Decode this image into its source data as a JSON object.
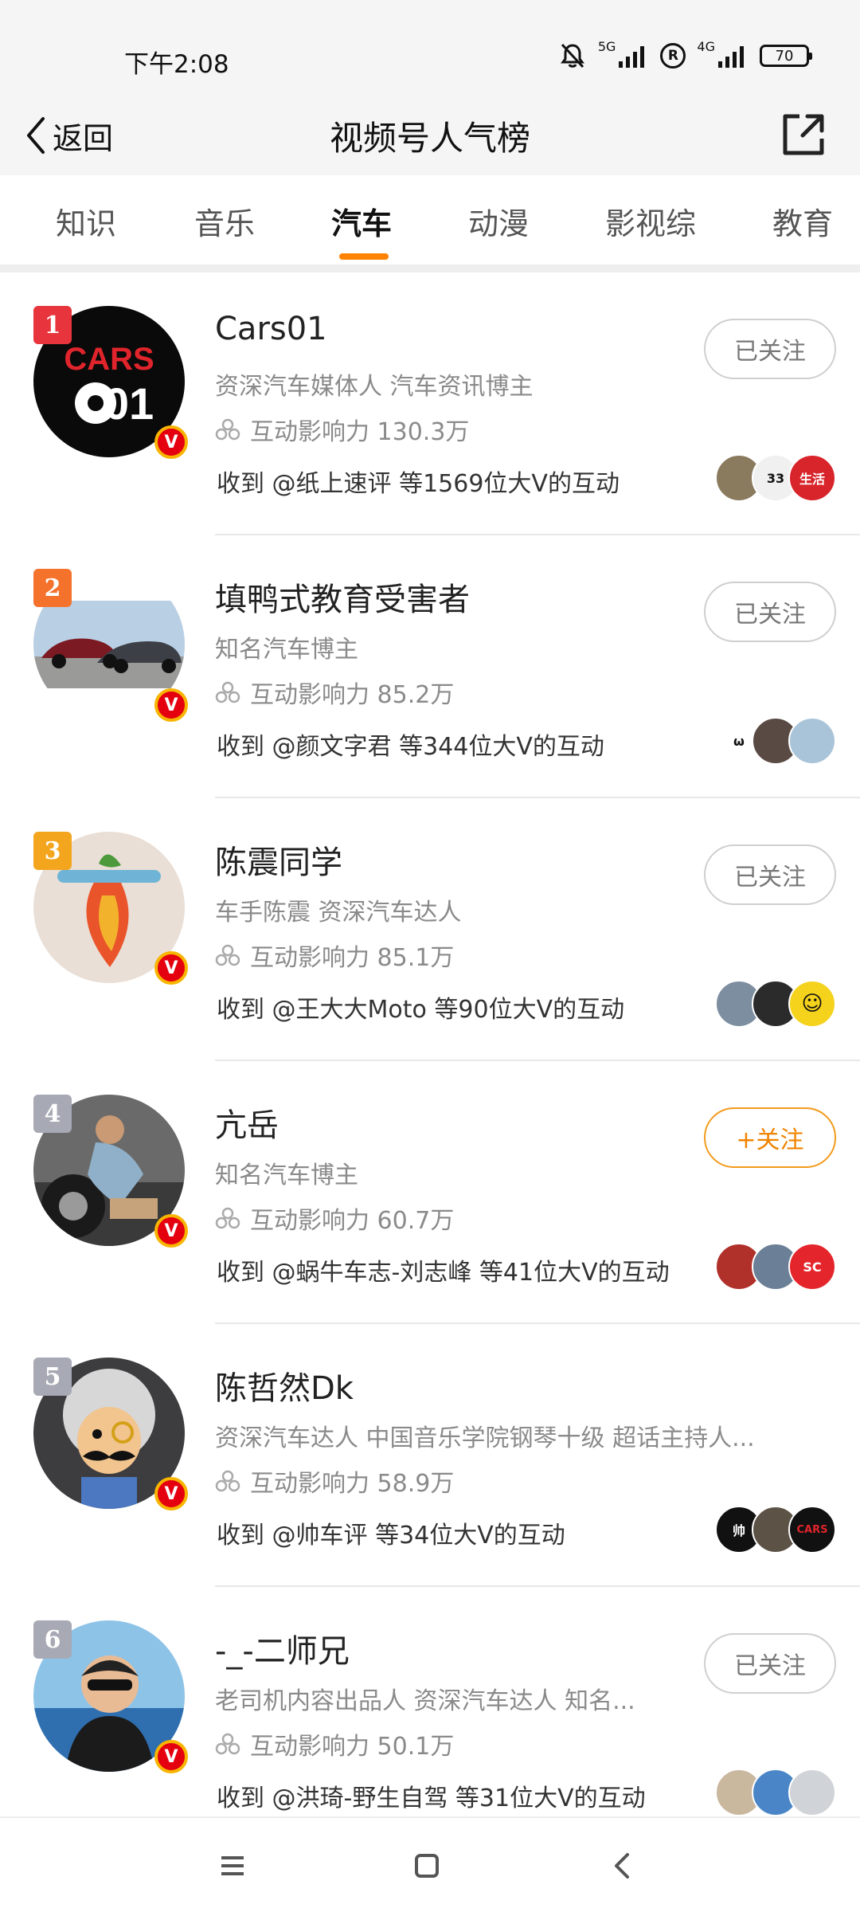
{
  "status_bar": {
    "time": "下午2:08",
    "network_5g": "5G",
    "network_4g": "4G",
    "battery": "70"
  },
  "nav": {
    "back_label": "返回",
    "title": "视频号人气榜"
  },
  "tabs": [
    {
      "label": "知识"
    },
    {
      "label": "音乐"
    },
    {
      "label": "汽车",
      "active": true
    },
    {
      "label": "动漫"
    },
    {
      "label": "影视综"
    },
    {
      "label": "教育"
    }
  ],
  "accent_color": "#ff8200",
  "list": [
    {
      "rank": "1",
      "name": "Cars01",
      "desc": "资深汽车媒体人 汽车资讯博主",
      "influence": "互动影响力 130.3万",
      "received": "收到 @纸上速评 等1569位大V的互动",
      "follow": "已关注",
      "followed": true
    },
    {
      "rank": "2",
      "name": "填鸭式教育受害者",
      "desc": "知名汽车博主",
      "influence": "互动影响力 85.2万",
      "received": "收到 @颜文字君 等344位大V的互动",
      "follow": "已关注",
      "followed": true
    },
    {
      "rank": "3",
      "name": "陈震同学",
      "desc": "车手陈震 资深汽车达人",
      "influence": "互动影响力 85.1万",
      "received": "收到 @王大大Moto 等90位大V的互动",
      "follow": "已关注",
      "followed": true
    },
    {
      "rank": "4",
      "name": "亢岳",
      "desc": "知名汽车博主",
      "influence": "互动影响力 60.7万",
      "received": "收到 @蜗牛车志-刘志峰 等41位大V的互动",
      "follow": "+关注",
      "followed": false
    },
    {
      "rank": "5",
      "name": "陈哲然Dk",
      "desc": "资深汽车达人 中国音乐学院钢琴十级 超话主持人...",
      "influence": "互动影响力 58.9万",
      "received": "收到 @帅车评 等34位大V的互动",
      "follow": "",
      "followed": null
    },
    {
      "rank": "6",
      "name": "-_-二师兄",
      "desc": "老司机内容出品人 资深汽车达人 知名...",
      "influence": "互动影响力 50.1万",
      "received": "收到 @洪琦-野生自驾 等31位大V的互动",
      "follow": "已关注",
      "followed": true
    }
  ],
  "avatar_text": {
    "cars01_logo": "CARS",
    "cars01_num": "01",
    "mini_33": "33",
    "mini_life": "生活",
    "mini_sc": "SC",
    "mini_shuai": "帅"
  },
  "verified_badge": "V"
}
